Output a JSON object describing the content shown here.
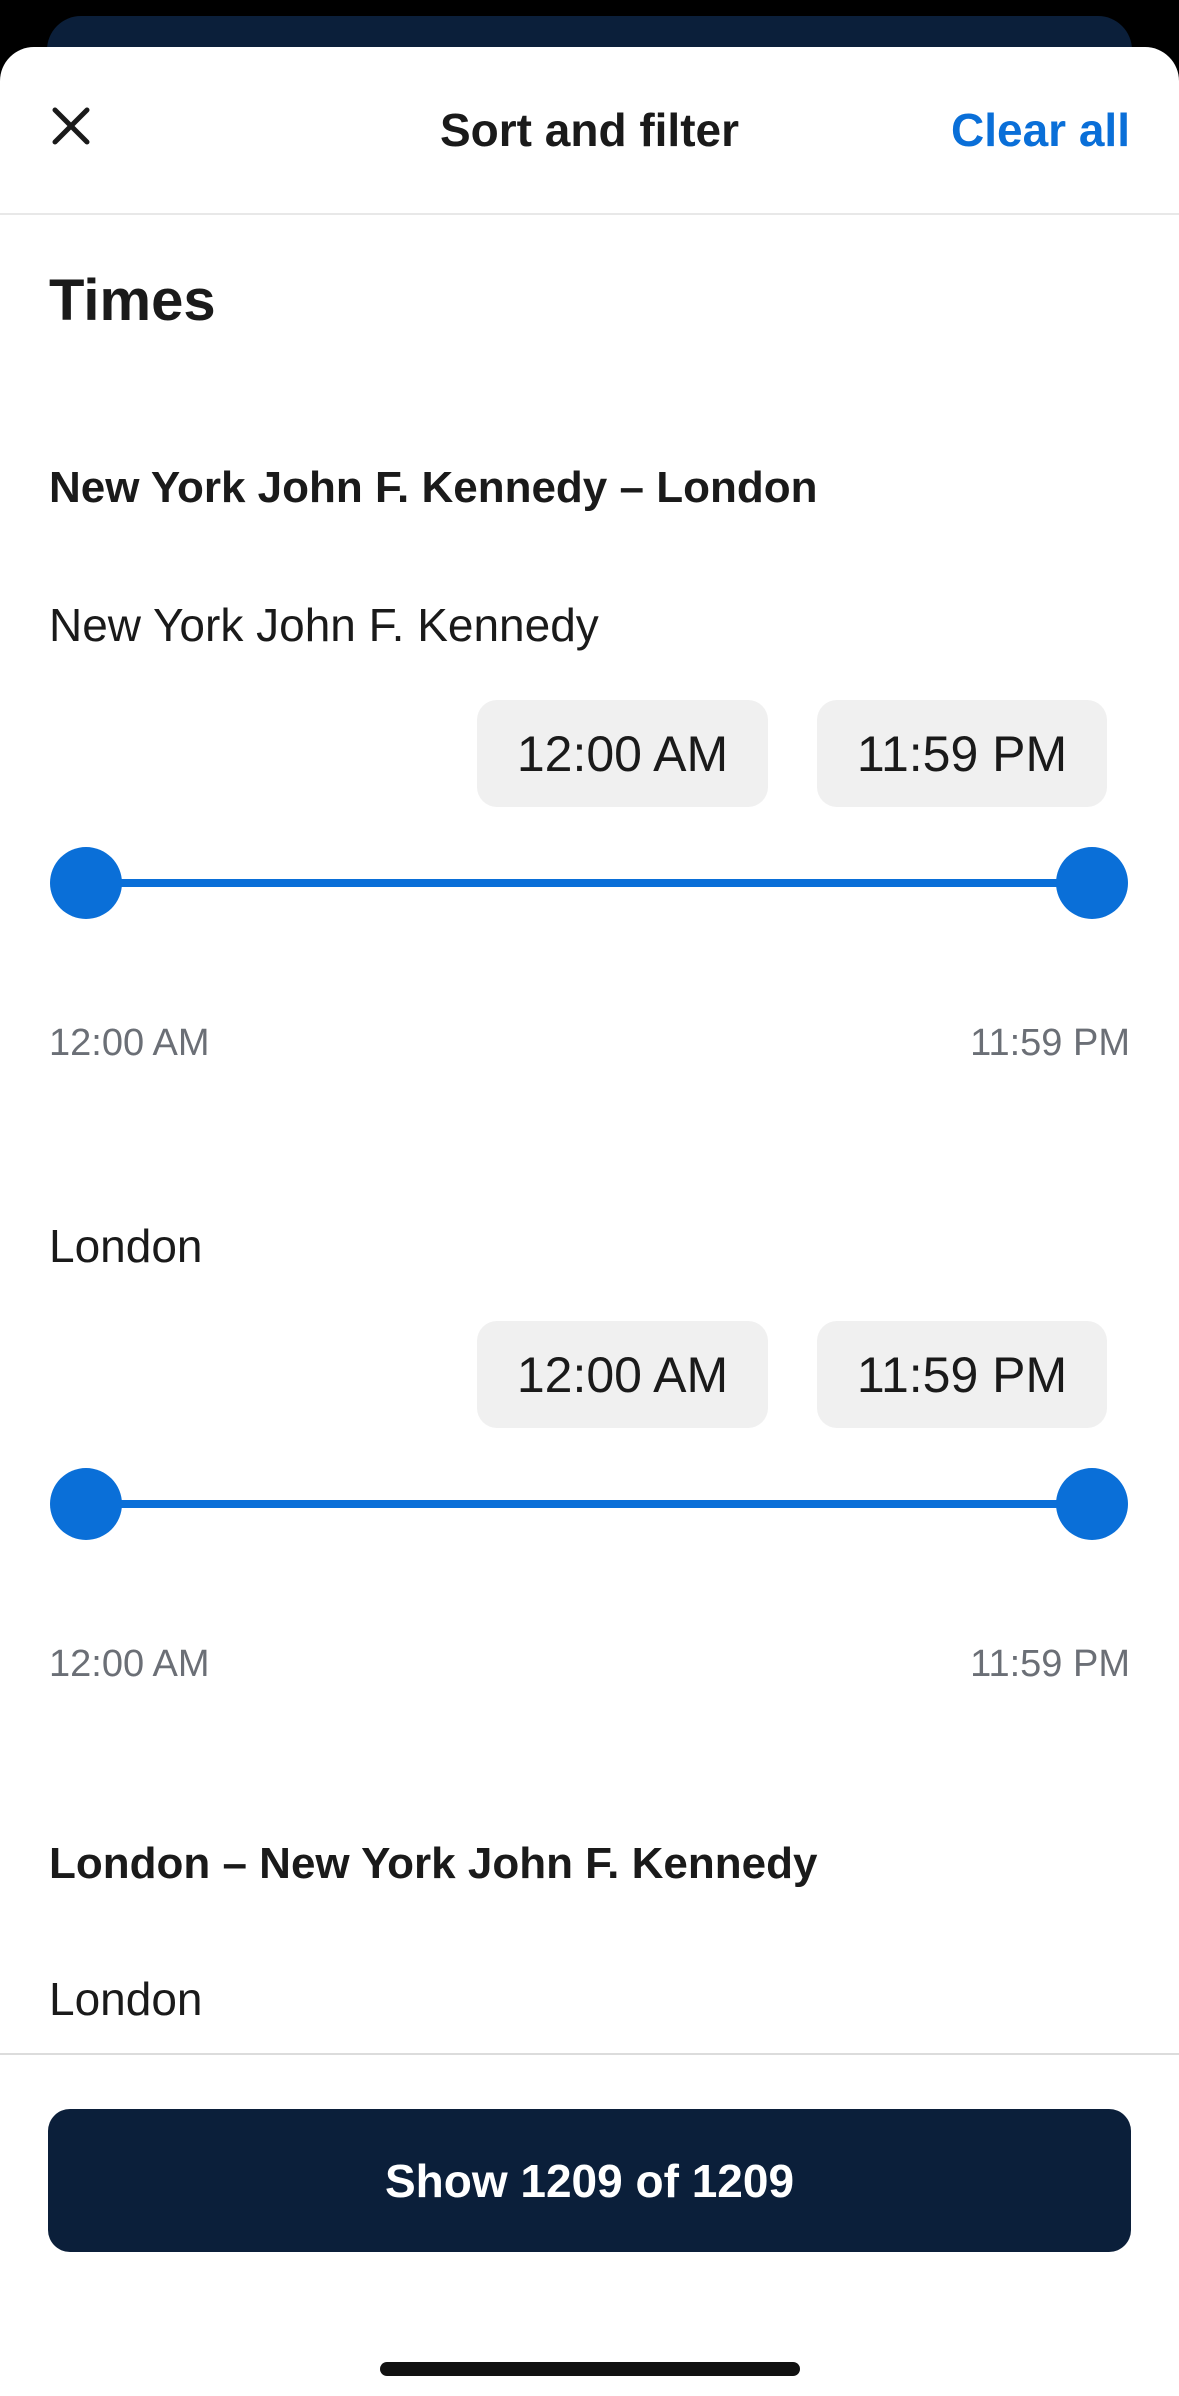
{
  "header": {
    "title": "Sort and filter",
    "clear_label": "Clear all",
    "close_icon": "close-icon"
  },
  "section": {
    "title": "Times"
  },
  "legs": [
    {
      "route_title": "New York John F. Kennedy – London",
      "airports": [
        {
          "name": "New York John F. Kennedy",
          "start_chip": "12:00 AM",
          "end_chip": "11:59 PM",
          "range_min": "12:00 AM",
          "range_max": "11:59 PM"
        },
        {
          "name": "London",
          "start_chip": "12:00 AM",
          "end_chip": "11:59 PM",
          "range_min": "12:00 AM",
          "range_max": "11:59 PM"
        }
      ]
    },
    {
      "route_title": "London – New York John F. Kennedy",
      "airports": [
        {
          "name": "London"
        }
      ]
    }
  ],
  "footer": {
    "show_label": "Show 1209 of 1209"
  },
  "colors": {
    "accent": "#0a6fd8",
    "dark": "#0b1f3a",
    "chip_bg": "#f0f0f0"
  }
}
